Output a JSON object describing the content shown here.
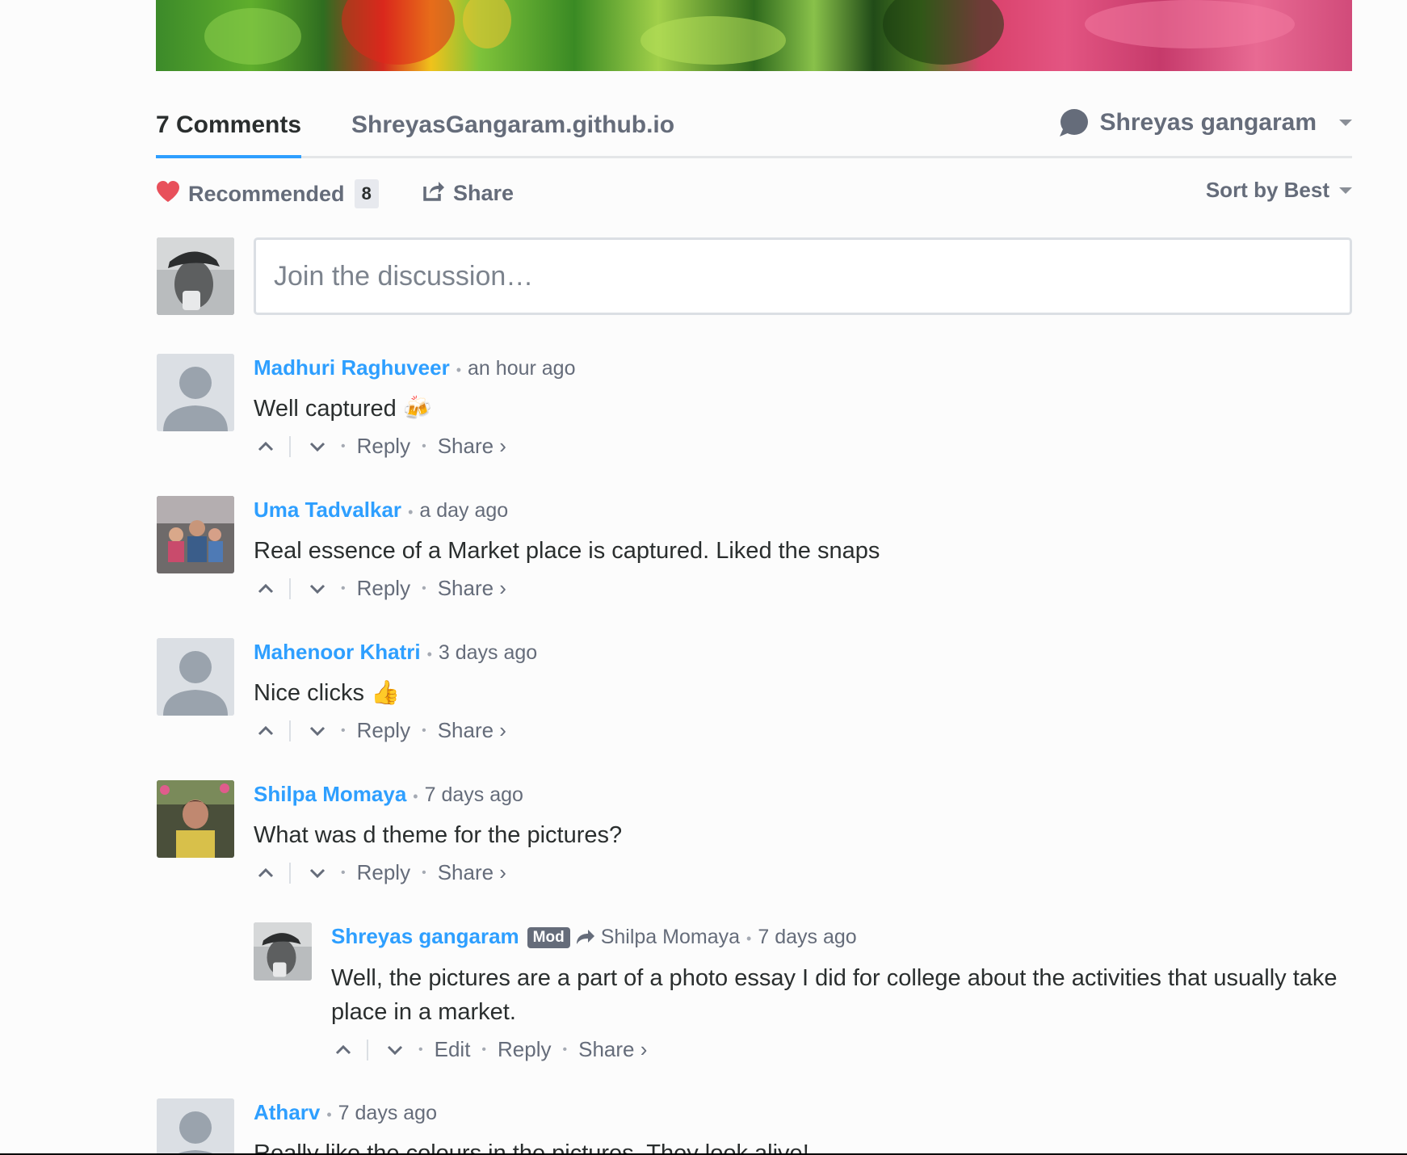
{
  "tabs": {
    "comments_label": "7 Comments",
    "site_label": "ShreyasGangaram.github.io",
    "user_name": "Shreyas gangaram"
  },
  "actions": {
    "recommend_label": "Recommended",
    "recommend_count": "8",
    "share_label": "Share",
    "sort_label": "Sort by Best"
  },
  "composer": {
    "placeholder": "Join the discussion…"
  },
  "comments": [
    {
      "author": "Madhuri Raghuveer",
      "time": "an hour ago",
      "body": "Well captured 🍻",
      "reply_label": "Reply",
      "share_label": "Share ›"
    },
    {
      "author": "Uma Tadvalkar",
      "time": "a day ago",
      "body": "Real essence of a Market place is captured. Liked the snaps",
      "reply_label": "Reply",
      "share_label": "Share ›"
    },
    {
      "author": "Mahenoor Khatri",
      "time": "3 days ago",
      "body": "Nice clicks 👍",
      "reply_label": "Reply",
      "share_label": "Share ›"
    },
    {
      "author": "Shilpa Momaya",
      "time": "7 days ago",
      "body": "What was d theme for the pictures?",
      "reply_label": "Reply",
      "share_label": "Share ›"
    },
    {
      "author": "Shreyas gangaram",
      "badge": "Mod",
      "reply_to": "Shilpa Momaya",
      "time": "7 days ago",
      "body": "Well, the pictures are a part of a photo essay I did for college about the activities that usually take place in a market.",
      "edit_label": "Edit",
      "reply_label": "Reply",
      "share_label": "Share ›"
    },
    {
      "author": "Atharv",
      "time": "7 days ago",
      "body": "Really like the colours in the pictures. They look alive!"
    }
  ],
  "colors": {
    "link_blue": "#2e9fff",
    "muted_gray": "#656c7a",
    "heart_red": "#e8505b"
  }
}
